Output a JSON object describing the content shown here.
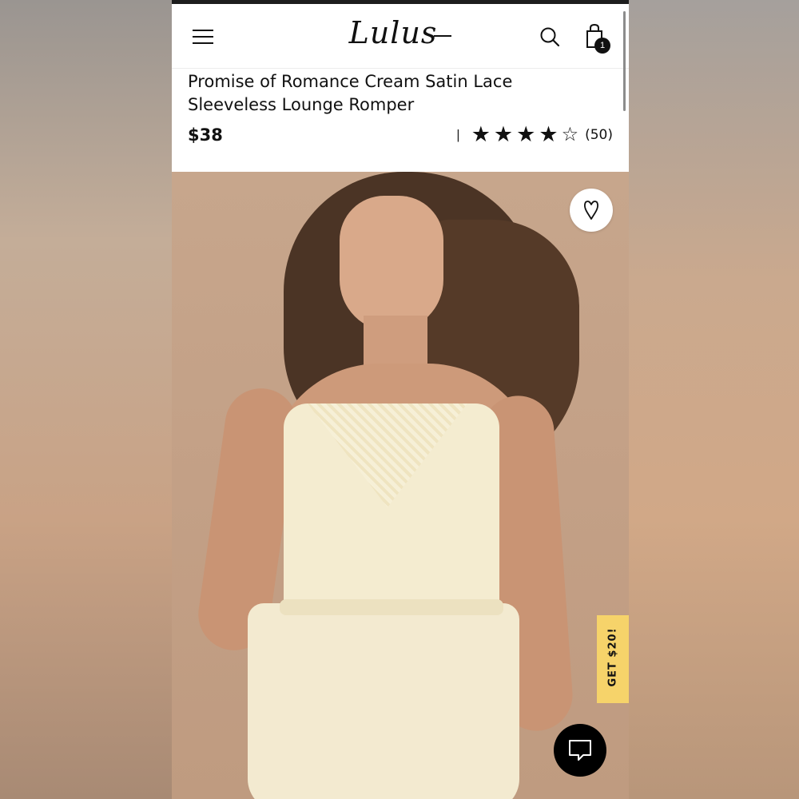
{
  "header": {
    "logo": "Lulus",
    "cart_count": "1"
  },
  "product": {
    "title": "Promise of Romance Cream Satin Lace Sleeveless Lounge Romper",
    "price": "$38",
    "rating": {
      "separator": "|",
      "stars": 4,
      "max_stars": 5,
      "count": "(50)"
    }
  },
  "promo": {
    "label": "GET $20!",
    "color": "#f6d36a"
  },
  "icons": {
    "menu": "hamburger-menu-icon",
    "search": "search-icon",
    "bag": "shopping-bag-icon",
    "favorite": "heart-icon",
    "chat": "chat-icon"
  }
}
